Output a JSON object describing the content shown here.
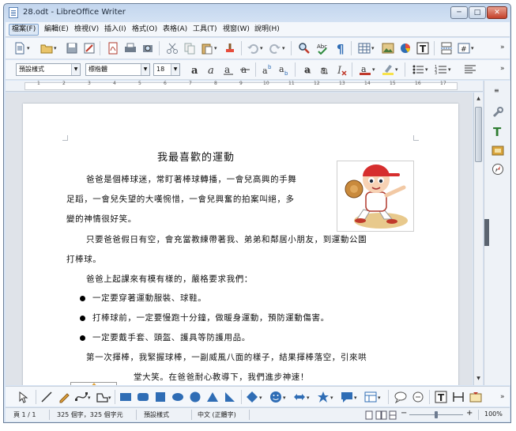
{
  "window": {
    "title": "28.odt - LibreOffice Writer"
  },
  "window_buttons": {
    "minimize": "─",
    "maximize": "□",
    "close": "✕"
  },
  "menubar": {
    "items": [
      "檔案(F)",
      "編輯(E)",
      "檢視(V)",
      "插入(I)",
      "格式(O)",
      "表格(A)",
      "工具(T)",
      "視窗(W)",
      "說明(H)"
    ]
  },
  "formatting": {
    "paragraph_style": "預設樣式",
    "font_name": "標楷體",
    "font_size": "18"
  },
  "ruler": {
    "numbers": [
      "1",
      "2",
      "3",
      "4",
      "5",
      "6",
      "7",
      "8",
      "9",
      "10",
      "11",
      "12",
      "13",
      "14",
      "15",
      "16",
      "17"
    ]
  },
  "document": {
    "title": "我最喜歡的運動",
    "paragraphs": [
      "爸爸是個棒球迷，常盯著棒球轉播，一會兒高興的手舞",
      "足蹈，一會兒失望的大嘆惋惜，一會兒興奮的拍案叫絕，多",
      "變的神情很好笑。",
      "只要爸爸假日有空，會充當教練帶著我、弟弟和鄰居小朋友，到運動公園",
      "打棒球。",
      "爸爸上起課來有模有樣的，嚴格要求我們："
    ],
    "bullets": [
      "一定要穿著運動服裝、球鞋。",
      "打棒球前，一定要慢跑十分鐘，做暖身運動，預防運動傷害。",
      "一定要戴手套、頭盔、護具等防護用品。"
    ],
    "closing": [
      "第一次揮棒，我緊握球棒，一副威風八面的樣子，結果揮棒落空，引來哄",
      "堂大笑。在爸爸耐心教導下，我們進步神速！"
    ]
  },
  "statusbar": {
    "page": "頁 1 / 1",
    "word_count": "325 個字，325 個字元",
    "page_style": "預設樣式",
    "language": "中文 (正體字)",
    "zoom": "100%",
    "zoom_fraction": 1.0
  },
  "colors": {
    "accent": "#3a6ea5",
    "window_frame": "#c3d6ee",
    "toolbar_bg": "#f4f7fb",
    "doc_background": "#dfe3e9",
    "shape_blue": "#2f6db5"
  },
  "icons": {
    "toolbar1": [
      "new-document-icon",
      "open-folder-icon",
      "save-icon",
      "edit-document-icon",
      "export-pdf-icon",
      "print-icon",
      "print-preview-icon",
      "cut-icon",
      "copy-icon",
      "paste-icon",
      "clone-formatting-icon",
      "undo-icon",
      "redo-icon",
      "find-replace-icon",
      "spellcheck-icon",
      "formatting-marks-icon",
      "insert-table-icon",
      "insert-image-icon",
      "insert-chart-icon",
      "insert-textbox-icon",
      "page-break-icon",
      "insert-field-icon"
    ],
    "toolbar2": [
      "bold-icon",
      "italic-icon",
      "underline-icon",
      "strikethrough-icon",
      "superscript-icon",
      "subscript-icon",
      "shadow-icon",
      "outline-icon",
      "clear-formatting-icon",
      "font-color-icon",
      "highlight-icon",
      "bullets-icon",
      "numbering-icon",
      "align-icon"
    ],
    "drawbar": [
      "select-icon",
      "line-icon",
      "pencil-icon",
      "curve-icon",
      "polygon-icon",
      "rectangle-icon",
      "rounded-rectangle-icon",
      "square-icon",
      "ellipse-icon",
      "circle-icon",
      "triangle-icon",
      "right-triangle-icon",
      "diamond-icon",
      "smiley-icon",
      "double-arrow-icon",
      "star-icon",
      "callout-icon",
      "flowchart-icon",
      "speech-bubble-icon",
      "text-box-icon",
      "vertical-text-icon",
      "fontwork-icon"
    ],
    "sidebar": [
      "properties-icon",
      "styles-icon",
      "gallery-icon",
      "navigator-icon"
    ]
  }
}
